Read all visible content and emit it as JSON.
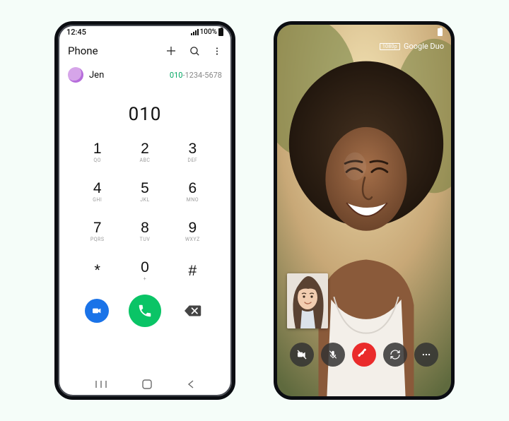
{
  "status": {
    "time": "12:45",
    "battery": "100%",
    "signal": "󰤨"
  },
  "phoneApp": {
    "header": {
      "title": "Phone"
    },
    "suggestion": {
      "name": "Jen",
      "matchDigits": "010",
      "restDigits": "-1234-5678"
    },
    "dialed": "010",
    "keys": [
      {
        "digit": "1",
        "sub": "QO"
      },
      {
        "digit": "2",
        "sub": "ABC"
      },
      {
        "digit": "3",
        "sub": "DEF"
      },
      {
        "digit": "4",
        "sub": "GHI"
      },
      {
        "digit": "5",
        "sub": "JKL"
      },
      {
        "digit": "6",
        "sub": "MNO"
      },
      {
        "digit": "7",
        "sub": "PQRS"
      },
      {
        "digit": "8",
        "sub": "TUV"
      },
      {
        "digit": "9",
        "sub": "WXYZ"
      },
      {
        "digit": "*",
        "sub": ""
      },
      {
        "digit": "0",
        "sub": "+"
      },
      {
        "digit": "#",
        "sub": ""
      }
    ]
  },
  "videoCall": {
    "quality": "1080p",
    "appName": "Google Duo"
  }
}
